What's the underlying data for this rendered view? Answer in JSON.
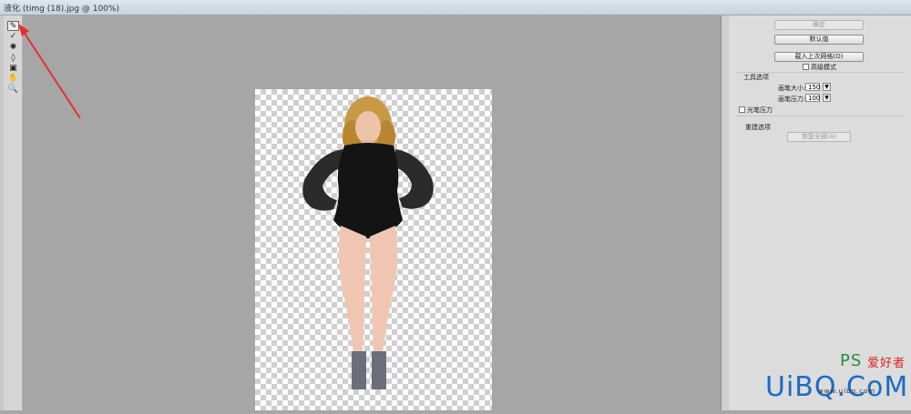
{
  "window": {
    "title": "液化 (timg (18).jpg @ 100%)"
  },
  "toolbar": {
    "tools": [
      "forward-warp",
      "reconstruct",
      "twirl",
      "pucker",
      "bloat",
      "hand",
      "zoom"
    ]
  },
  "panel": {
    "ok_label": "确定",
    "default_label": "默认值",
    "load_last_label": "载入上次网格(O)",
    "advanced_mode_label": "高级模式",
    "tool_options_heading": "工具选项",
    "brush_size_label": "画笔大小:",
    "brush_size_value": "150",
    "brush_pressure_label": "画笔压力:",
    "brush_pressure_value": "100",
    "stylus_pressure_label": "光笔压力",
    "reconstruct_heading": "重建选项",
    "restore_all_label": "恢复全部(A)"
  },
  "watermark": {
    "brand": "UiBQ.CoM",
    "ps_text": "PS",
    "cn_text": "爱好者",
    "url": "www.uibq.com"
  },
  "colors": {
    "arrow": "#e53030",
    "canvas": "#a6a6a6",
    "panel": "#dcdcdc",
    "watermark": "#1a6cc4"
  }
}
